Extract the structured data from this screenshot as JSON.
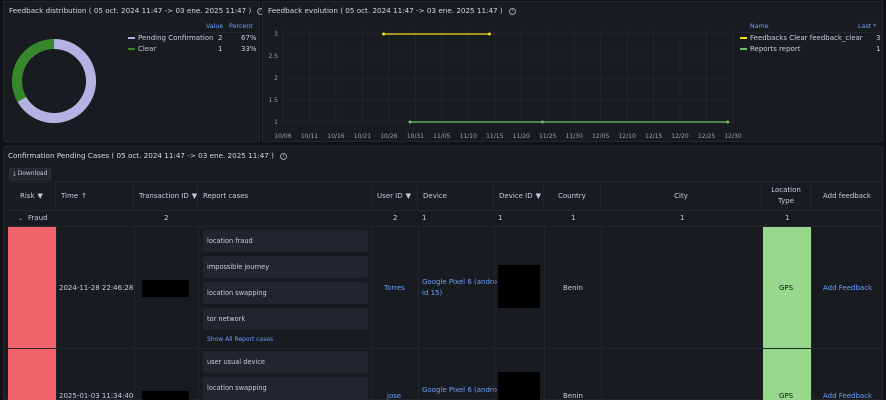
{
  "distribution": {
    "title": "Feedback distribution ( 05 oct. 2024 11:47 -> 03 ene. 2025 11:47 )",
    "legend_headers": {
      "value": "Value",
      "percent": "Percent"
    },
    "items": [
      {
        "name": "Pending Confirmation",
        "value": "2",
        "percent": "67%",
        "color": "#b4b2e2",
        "fraction": 0.667
      },
      {
        "name": "Clear",
        "value": "1",
        "percent": "33%",
        "color": "#37872d",
        "fraction": 0.333
      }
    ]
  },
  "evolution": {
    "title": "Feedback evolution ( 05 oct. 2024 11:47 -> 03 ene. 2025 11:47 )",
    "legend_headers": {
      "name": "Name",
      "last": "Last *"
    },
    "legend": [
      {
        "name": "Feedbacks Clear feedback_clear",
        "last": "3",
        "color": "#fade2a"
      },
      {
        "name": "Reports report",
        "last": "1",
        "color": "#73bf69"
      }
    ]
  },
  "chart_data": {
    "type": "line",
    "y_ticks": [
      "1",
      "1.5",
      "2",
      "2.5",
      "3"
    ],
    "ylim": [
      1,
      3
    ],
    "x_ticks": [
      "10/06",
      "10/11",
      "10/16",
      "10/21",
      "10/26",
      "10/31",
      "11/05",
      "11/10",
      "11/15",
      "11/20",
      "11/25",
      "11/30",
      "12/05",
      "12/10",
      "12/15",
      "12/20",
      "12/25",
      "12/30"
    ],
    "series": [
      {
        "name": "Feedbacks Clear feedback_clear",
        "color": "#fade2a",
        "points": [
          [
            "10/25",
            3
          ],
          [
            "11/14",
            3
          ]
        ]
      },
      {
        "name": "Reports report",
        "color": "#73bf69",
        "points": [
          [
            "10/30",
            1
          ],
          [
            "11/24",
            1
          ],
          [
            "12/29",
            1
          ]
        ]
      }
    ]
  },
  "cases": {
    "title": "Confirmation Pending Cases ( 05 oct. 2024 11:47 -> 03 ene. 2025 11:47 )",
    "download_label": "Download",
    "columns": {
      "risk": "Risk",
      "time": "Time",
      "transaction_id": "Transaction ID",
      "report_cases": "Report cases",
      "user_id": "User ID",
      "device": "Device",
      "device_id": "Device ID",
      "country": "Country",
      "city": "City",
      "location_type": "Location Type",
      "add_feedback": "Add feedback"
    },
    "group": {
      "name": "Fraud",
      "transaction_id": "2",
      "user_id": "2",
      "device": "1",
      "device_id": "1",
      "country": "1",
      "city": "1",
      "location_type": "1"
    },
    "rows": [
      {
        "time": "2024-11-28 22:46:28",
        "reports": [
          "location fraud",
          "impossible journey",
          "location swapping",
          "tor network"
        ],
        "show_all": "Show All Report cases",
        "user": "Torres",
        "device_line1": "Google Pixel 6 (andro",
        "device_line2": "id 15)",
        "country": "Benin",
        "location_type": "GPS",
        "add_feedback": "Add Feedback"
      },
      {
        "time": "2025-01-03 11:34:40",
        "reports": [
          "user usual device",
          "location swapping"
        ],
        "user": "jose",
        "device_line1": "Google Pixel 6 (andro",
        "country": "Benin",
        "location_type": "GPS",
        "add_feedback": "Add Feedback"
      }
    ]
  }
}
